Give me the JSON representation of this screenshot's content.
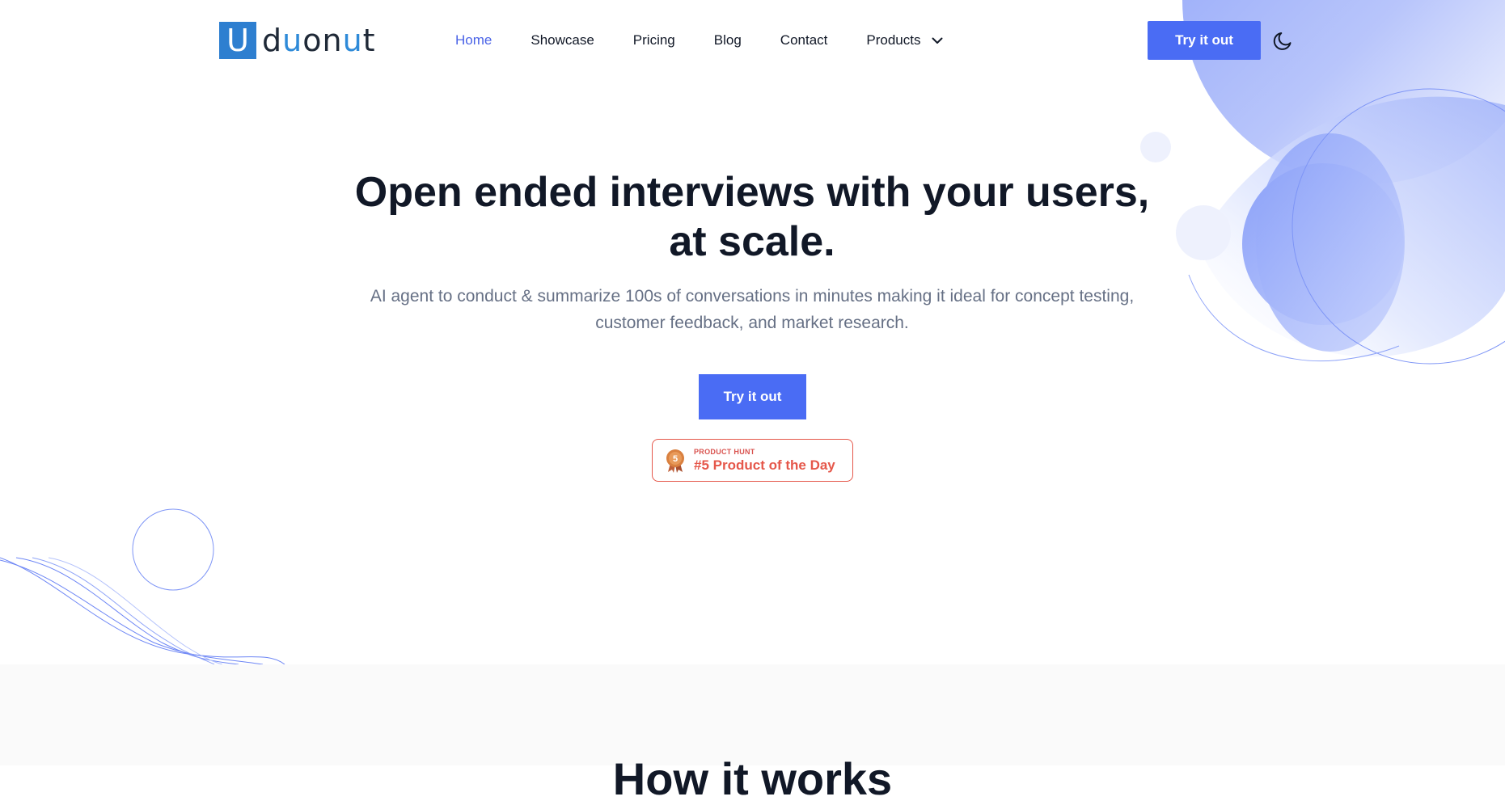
{
  "brand": {
    "logo_letter": "U",
    "logo_word_part1": "d",
    "logo_word_u1": "u",
    "logo_word_part2": "on",
    "logo_word_u2": "u",
    "logo_word_part3": "t"
  },
  "nav": {
    "items": [
      {
        "label": "Home",
        "active": true
      },
      {
        "label": "Showcase"
      },
      {
        "label": "Pricing"
      },
      {
        "label": "Blog"
      },
      {
        "label": "Contact"
      },
      {
        "label": "Products",
        "has_dropdown": true,
        "icon": "chevron-down-icon"
      }
    ]
  },
  "header": {
    "cta_label": "Try it out",
    "theme_toggle_icon": "moon-icon"
  },
  "hero": {
    "title_line1": "Open ended interviews with your users,",
    "title_line2": "at scale.",
    "subtitle_line1": "AI agent to conduct & summarize 100s of conversations in minutes making it ideal for concept testing,",
    "subtitle_line2": "customer feedback, and market research.",
    "cta_label": "Try it out"
  },
  "badge": {
    "medal_number": "5",
    "kicker": "PRODUCT HUNT",
    "text": "#5 Product of the Day",
    "icon": "medal-icon"
  },
  "section2": {
    "heading_partial": "How it works"
  },
  "colors": {
    "primary": "#4a6cf4",
    "nav_active": "#4a63e7",
    "logo_blue": "#2e7fd0",
    "badge_red": "#e5574a",
    "deco_blue": "#a8b8fb"
  }
}
